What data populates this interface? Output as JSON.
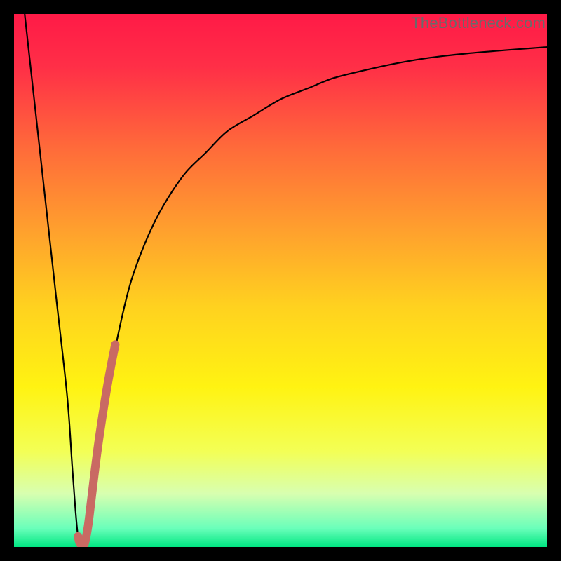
{
  "watermark": "TheBottleneck.com",
  "colors": {
    "gradient_stops": [
      {
        "offset": 0.0,
        "color": "#ff1a47"
      },
      {
        "offset": 0.1,
        "color": "#ff2f47"
      },
      {
        "offset": 0.25,
        "color": "#ff6a3a"
      },
      {
        "offset": 0.4,
        "color": "#ff9e2e"
      },
      {
        "offset": 0.55,
        "color": "#ffd21f"
      },
      {
        "offset": 0.7,
        "color": "#fff312"
      },
      {
        "offset": 0.82,
        "color": "#f3ff55"
      },
      {
        "offset": 0.9,
        "color": "#d8ffb0"
      },
      {
        "offset": 0.965,
        "color": "#6affba"
      },
      {
        "offset": 1.0,
        "color": "#00e682"
      }
    ],
    "curve": "#000000",
    "highlight": "#c96a63"
  },
  "chart_data": {
    "type": "line",
    "title": "",
    "xlabel": "",
    "ylabel": "",
    "xlim": [
      0,
      100
    ],
    "ylim": [
      0,
      100
    ],
    "grid": false,
    "legend": false,
    "series": [
      {
        "name": "bottleneck-curve",
        "x": [
          2,
          4,
          6,
          8,
          10,
          11,
          12,
          13,
          14,
          16,
          18,
          20,
          22,
          25,
          28,
          32,
          36,
          40,
          45,
          50,
          55,
          60,
          66,
          72,
          78,
          85,
          92,
          100
        ],
        "y": [
          100,
          82,
          64,
          46,
          28,
          14,
          2,
          0,
          6,
          20,
          32,
          42,
          50,
          58,
          64,
          70,
          74,
          78,
          81,
          84,
          86,
          88,
          89.5,
          90.8,
          91.8,
          92.6,
          93.2,
          93.8
        ]
      },
      {
        "name": "highlight-segment",
        "x": [
          12.0,
          12.3,
          12.8,
          13.0,
          13.4,
          13.9,
          14.4,
          15.0,
          15.7,
          16.5,
          17.3,
          18.2,
          19.0
        ],
        "y": [
          2.0,
          0.8,
          0.2,
          0.0,
          1.2,
          4.0,
          8.0,
          13.0,
          18.5,
          24.0,
          29.0,
          34.0,
          38.0
        ]
      }
    ]
  }
}
